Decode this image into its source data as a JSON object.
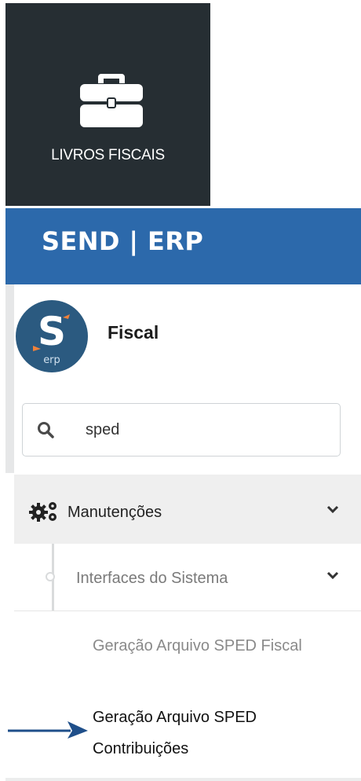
{
  "tile": {
    "label": "LIVROS FISCAIS",
    "icon": "briefcase-icon"
  },
  "appbar": {
    "title": "SEND | ERP",
    "color": "#2c69ab"
  },
  "module": {
    "name": "Fiscal",
    "logo": {
      "letter": "S",
      "sub": "erp",
      "bg": "#2b5a80",
      "accent": "#f0813a"
    }
  },
  "search": {
    "value": "sped",
    "placeholder": ""
  },
  "menu": {
    "group": {
      "label": "Manutenções",
      "icon": "gears-icon"
    },
    "subgroup": {
      "label": "Interfaces do Sistema"
    },
    "items": [
      {
        "label": "Geração Arquivo SPED Fiscal"
      },
      {
        "line1": "Geração Arquivo SPED",
        "line2": "Contribuições"
      }
    ]
  },
  "annotation": {
    "arrow_color": "#1f4f8a"
  }
}
